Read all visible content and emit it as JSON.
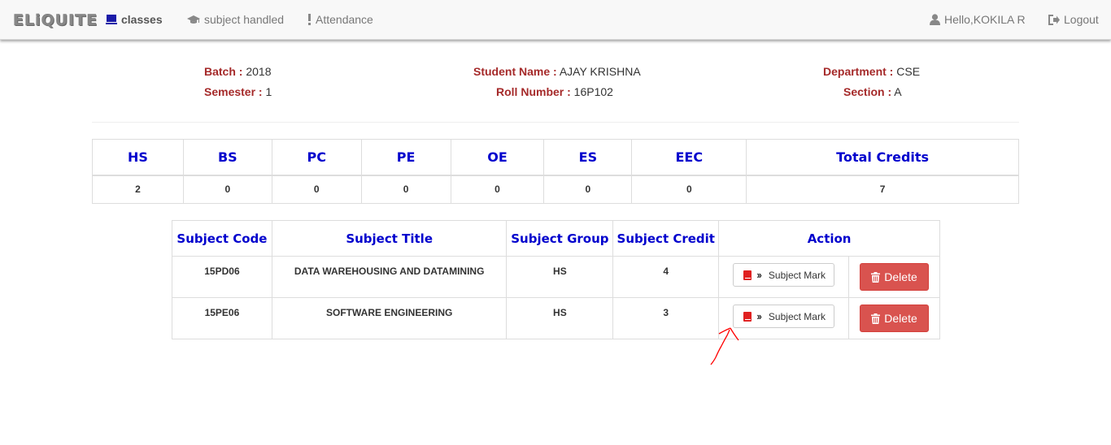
{
  "navbar": {
    "brand": "ELiQUITE",
    "items": [
      {
        "label": "classes",
        "icon": "monitor-icon",
        "active": true
      },
      {
        "label": "subject handled",
        "icon": "graduation-cap-icon",
        "active": false
      },
      {
        "label": "Attendance",
        "icon": "exclamation-icon",
        "active": false
      }
    ],
    "user_greeting": "Hello,KOKILA R",
    "logout_label": "Logout"
  },
  "student": {
    "batch_label": "Batch :",
    "batch": "2018",
    "semester_label": "Semester :",
    "semester": "1",
    "name_label": "Student Name :",
    "name": "AJAY KRISHNA",
    "roll_label": "Roll Number :",
    "roll": "16P102",
    "department_label": "Department :",
    "department": "CSE",
    "section_label": "Section :",
    "section": "A"
  },
  "credits": {
    "headers": [
      "HS",
      "BS",
      "PC",
      "PE",
      "OE",
      "ES",
      "EEC",
      "Total Credits"
    ],
    "values": [
      "2",
      "0",
      "0",
      "0",
      "0",
      "0",
      "0",
      "7"
    ]
  },
  "subjects": {
    "headers": [
      "Subject Code",
      "Subject Title",
      "Subject Group",
      "Subject Credit",
      "Action"
    ],
    "rows": [
      {
        "code": "15PD06",
        "title": "DATA WAREHOUSING AND DATAMINING",
        "group": "HS",
        "credit": "4"
      },
      {
        "code": "15PE06",
        "title": "SOFTWARE ENGINEERING",
        "group": "HS",
        "credit": "3"
      }
    ],
    "mark_button_label": "Subject Mark",
    "delete_button_label": "Delete"
  },
  "colors": {
    "accent_blue": "#0000cd",
    "label_red": "#a52a2a",
    "delete_red": "#d9534f",
    "annotation_red": "#ff0000"
  }
}
